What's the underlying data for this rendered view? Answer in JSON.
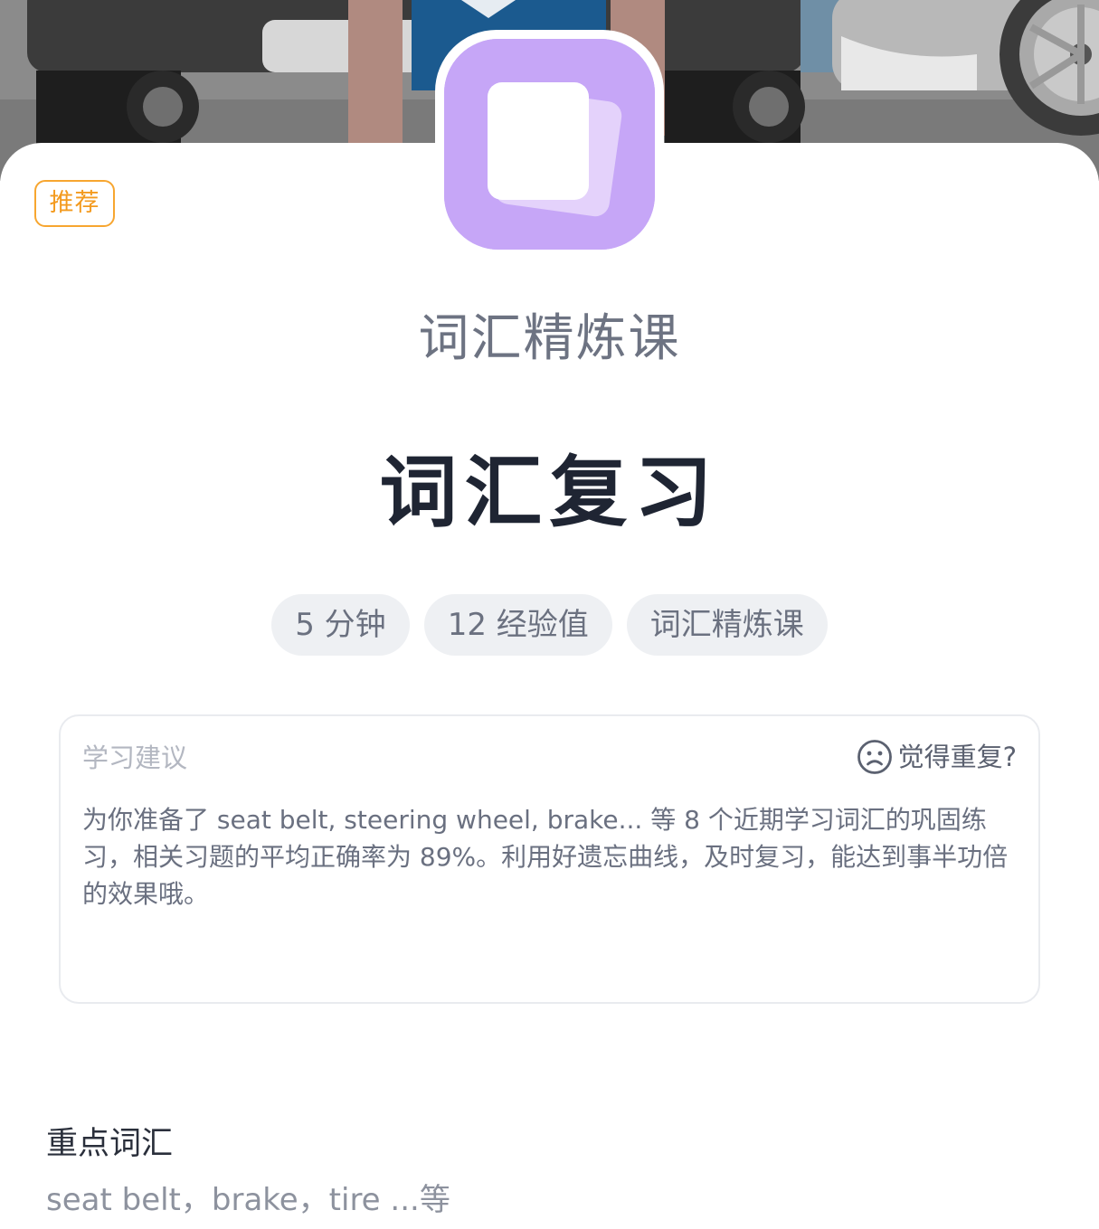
{
  "banner": {
    "illustration": "street-scene-with-cars-and-person"
  },
  "app_icon": {
    "icon": "flashcards-icon",
    "color": "#c6a6f7"
  },
  "badge": {
    "label": "推荐",
    "color": "#f7a630"
  },
  "course_name": "词汇精炼课",
  "lesson_title": "词汇复习",
  "chips": [
    {
      "label": "5 分钟"
    },
    {
      "label": "12 经验值"
    },
    {
      "label": "词汇精炼课"
    }
  ],
  "advice": {
    "label": "学习建议",
    "repeat_label": "觉得重复?",
    "repeat_icon": "sad-face-icon",
    "text": "为你准备了 seat belt, steering wheel, brake... 等 8 个近期学习词汇的巩固练习，相关习题的平均正确率为 89%。利用好遗忘曲线，及时复习，能达到事半功倍的效果哦。"
  },
  "key_vocab": {
    "title": "重点词汇",
    "words": "seat belt，brake，tire ...等"
  }
}
